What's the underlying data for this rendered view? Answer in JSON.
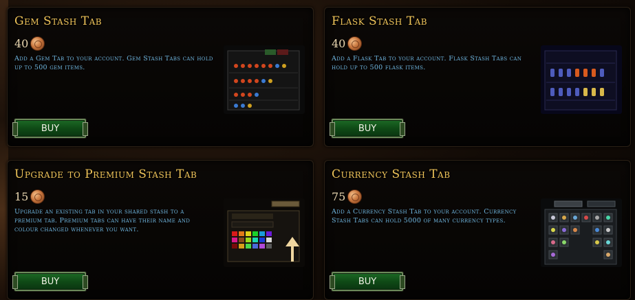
{
  "cards": [
    {
      "title": "Gem Stash Tab",
      "price": "40",
      "description": "Add a Gem Tab to your account. Gem Stash Tabs can hold up to 500 gem items.",
      "buy_label": "BUY",
      "icon": "gem-stash-preview"
    },
    {
      "title": "Flask Stash Tab",
      "price": "40",
      "description": "Add a Flask Tab to your account. Flask Stash Tabs can hold up to 500 flask items.",
      "buy_label": "BUY",
      "icon": "flask-stash-preview"
    },
    {
      "title": "Upgrade to Premium Stash Tab",
      "price": "15",
      "description": "Upgrade an existing tab in your shared stash to a premium tab. Premium tabs can have their name and colour changed whenever you want.",
      "buy_label": "BUY",
      "icon": "premium-stash-preview"
    },
    {
      "title": "Currency Stash Tab",
      "price": "75",
      "description": "Add a Currency Stash Tab to your account. Currency Stash Tabs can hold 5000 of many currency types.",
      "buy_label": "BUY",
      "icon": "currency-stash-preview"
    }
  ],
  "colors": {
    "title": "#f0c55a",
    "description": "#6fb6e0",
    "buy_button": "#1d6a26"
  },
  "currency_icon": "coin-icon"
}
